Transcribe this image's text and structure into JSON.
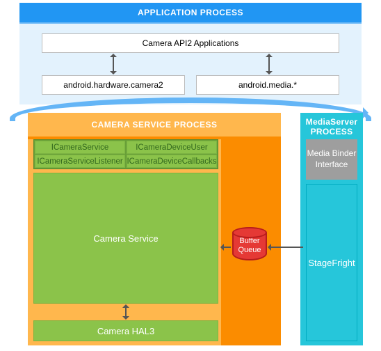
{
  "application_process": {
    "title": "APPLICATION PROCESS",
    "api2_label": "Camera API2 Applications",
    "hw_camera2": "android.hardware.camera2",
    "media_pkg": "android.media.*"
  },
  "camera_service_process": {
    "title": "CAMERA SERVICE PROCESS",
    "cells": {
      "icamera_service": "ICameraService",
      "icamera_device_user": "ICameraDeviceUser",
      "icamera_service_listener": "ICameraServiceListener",
      "icamera_device_callbacks": "ICameraDeviceCallbacks"
    },
    "camera_service": "Camera Service",
    "camera_hal3": "Camera HAL3"
  },
  "mediaserver_process": {
    "title": "MediaServer PROCESS",
    "media_binder": "Media Binder Interface",
    "stagefright": "StageFright"
  },
  "buffer_queue": "Buffer Queue"
}
